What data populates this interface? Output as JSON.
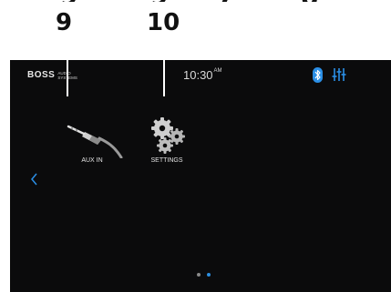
{
  "callouts": {
    "aux_number": "9",
    "settings_number": "10"
  },
  "status_bar": {
    "brand_name": "BOSS",
    "brand_sub": "AUDIO\nSYSTEMS",
    "time": "10:30",
    "time_suffix": "AM",
    "icons": [
      "bluetooth-icon",
      "equalizer-icon"
    ]
  },
  "apps": [
    {
      "label": "AUX IN",
      "icon": "aux-cable-icon"
    },
    {
      "label": "SETTINGS",
      "icon": "gears-icon"
    }
  ],
  "navigation": {
    "back_icon": "chevron-left-icon"
  },
  "pager": {
    "page_count": 2,
    "current_page": 2
  },
  "colors": {
    "screen_background": "#0b0b0c",
    "accent": "#2d8fe0",
    "text": "#e3e3e3"
  }
}
